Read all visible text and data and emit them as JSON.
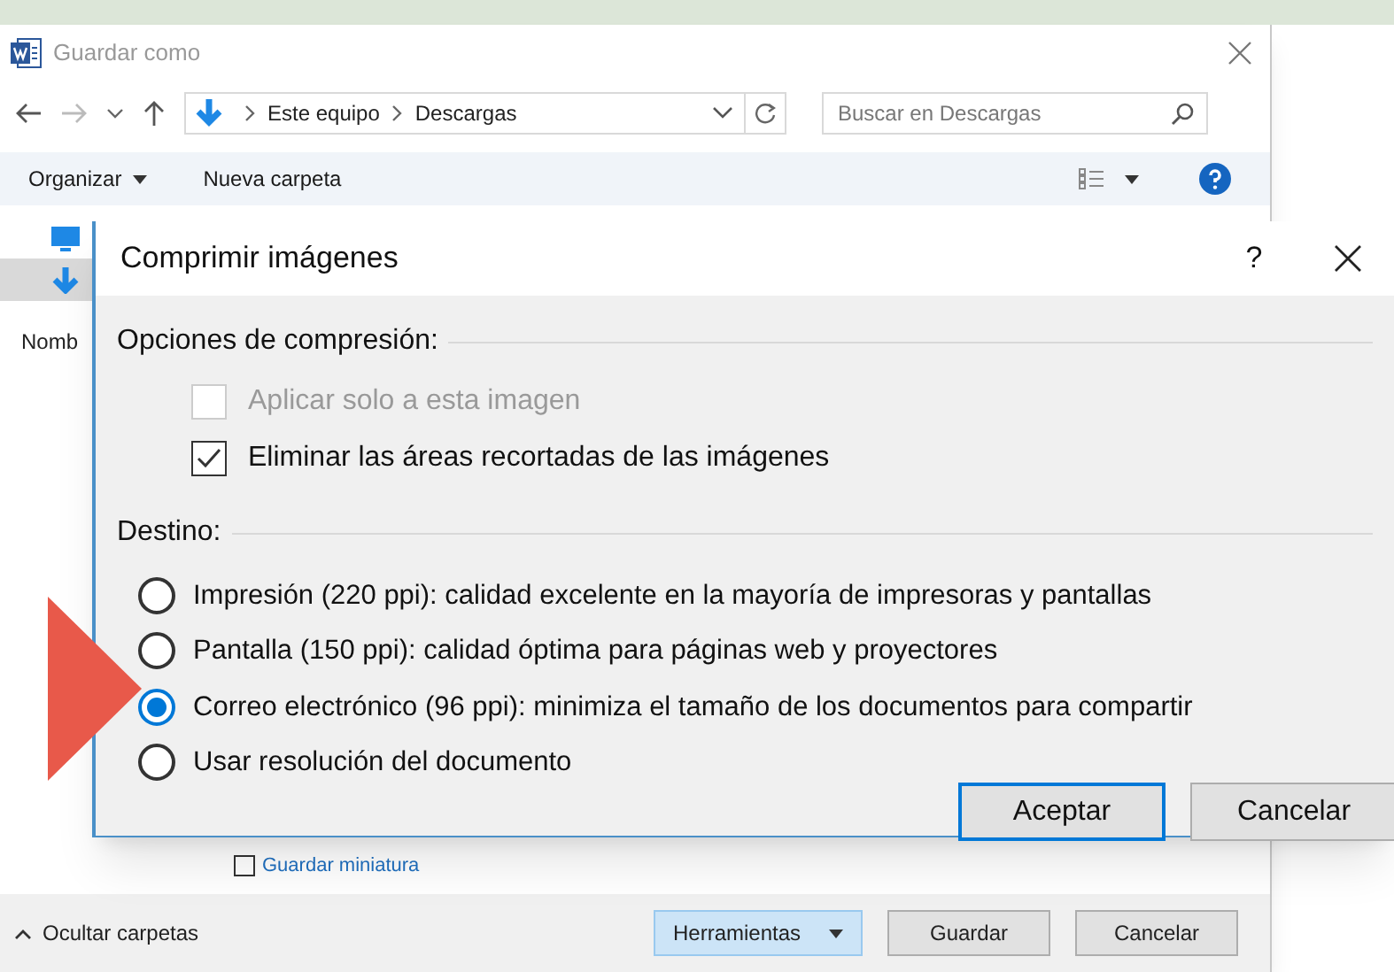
{
  "save_dialog": {
    "title": "Guardar como",
    "breadcrumb": [
      "Este equipo",
      "Descargas"
    ],
    "search": {
      "placeholder": "Buscar en Descargas"
    },
    "toolbar": {
      "organize": "Organizar",
      "new_folder": "Nueva carpeta"
    },
    "sidebar": [
      {
        "kind": "computer",
        "selected": false
      },
      {
        "kind": "downloads",
        "selected": true
      }
    ],
    "name_label": "Nomb",
    "thumbnail_checkbox": {
      "label": "Guardar miniatura",
      "checked": false
    },
    "hide_folders": "Ocultar carpetas",
    "buttons": [
      {
        "label": "Herramientas",
        "kind": "menu"
      },
      {
        "label": "Guardar",
        "kind": "plain"
      },
      {
        "label": "Cancelar",
        "kind": "plain"
      }
    ]
  },
  "compress_dialog": {
    "title": "Comprimir imágenes",
    "help": "?",
    "options_heading": "Opciones de compresión:",
    "options": [
      {
        "label": "Aplicar solo a esta imagen",
        "checked": false,
        "disabled": true
      },
      {
        "label": "Eliminar las áreas recortadas de las imágenes",
        "checked": true,
        "disabled": false
      }
    ],
    "target_heading": "Destino:",
    "targets": [
      {
        "label": "Impresión (220 ppi): calidad excelente en la mayoría de impresoras y pantallas",
        "selected": false
      },
      {
        "label": "Pantalla (150 ppi): calidad óptima para páginas web y proyectores",
        "selected": false
      },
      {
        "label": "Correo electrónico (96 ppi): minimiza el tamaño de los documentos para compartir",
        "selected": true
      },
      {
        "label": "Usar resolución del documento",
        "selected": false
      }
    ],
    "buttons": [
      {
        "label": "Aceptar",
        "default": true
      },
      {
        "label": "Cancelar",
        "default": false
      }
    ]
  }
}
